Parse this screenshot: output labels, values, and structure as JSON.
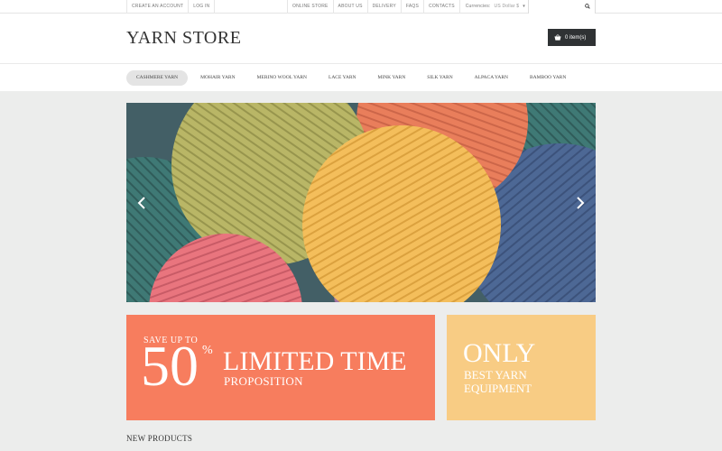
{
  "topbar": {
    "left_links": [
      "Create an account",
      "Log in"
    ],
    "right_links": [
      "Online Store",
      "About Us",
      "Delivery",
      "FAQs",
      "Contacts"
    ],
    "currencies_label": "Currencies:",
    "currency_value": "US Dollar $",
    "search": {
      "placeholder": "",
      "icon": "search-icon"
    }
  },
  "header": {
    "logo": "YARN STORE",
    "cart_label": "0 item(s)",
    "cart_icon": "basket-icon"
  },
  "nav": {
    "items": [
      {
        "label": "Cashmere Yarn",
        "active": true
      },
      {
        "label": "Mohair Yarn",
        "active": false
      },
      {
        "label": "Merino Wool Yarn",
        "active": false
      },
      {
        "label": "Lace Yarn",
        "active": false
      },
      {
        "label": "Mink Yarn",
        "active": false
      },
      {
        "label": "Silk Yarn",
        "active": false
      },
      {
        "label": "Alpaca Yarn",
        "active": false
      },
      {
        "label": "Bamboo Yarn",
        "active": false
      }
    ]
  },
  "slider": {
    "prev_icon": "chevron-left-icon",
    "next_icon": "chevron-right-icon"
  },
  "banners": {
    "sale": {
      "save_text": "SAVE UP TO",
      "number": "50",
      "percent": "%",
      "title": "LIMITED TIME",
      "subtitle": "PROPOSITION",
      "color": "#f77d5e"
    },
    "only": {
      "title": "ONLY",
      "subtitle": "BEST YARN EQUIPMENT",
      "color": "#f8cc84"
    }
  },
  "sections": {
    "new_products": "NEW PRODUCTS"
  }
}
